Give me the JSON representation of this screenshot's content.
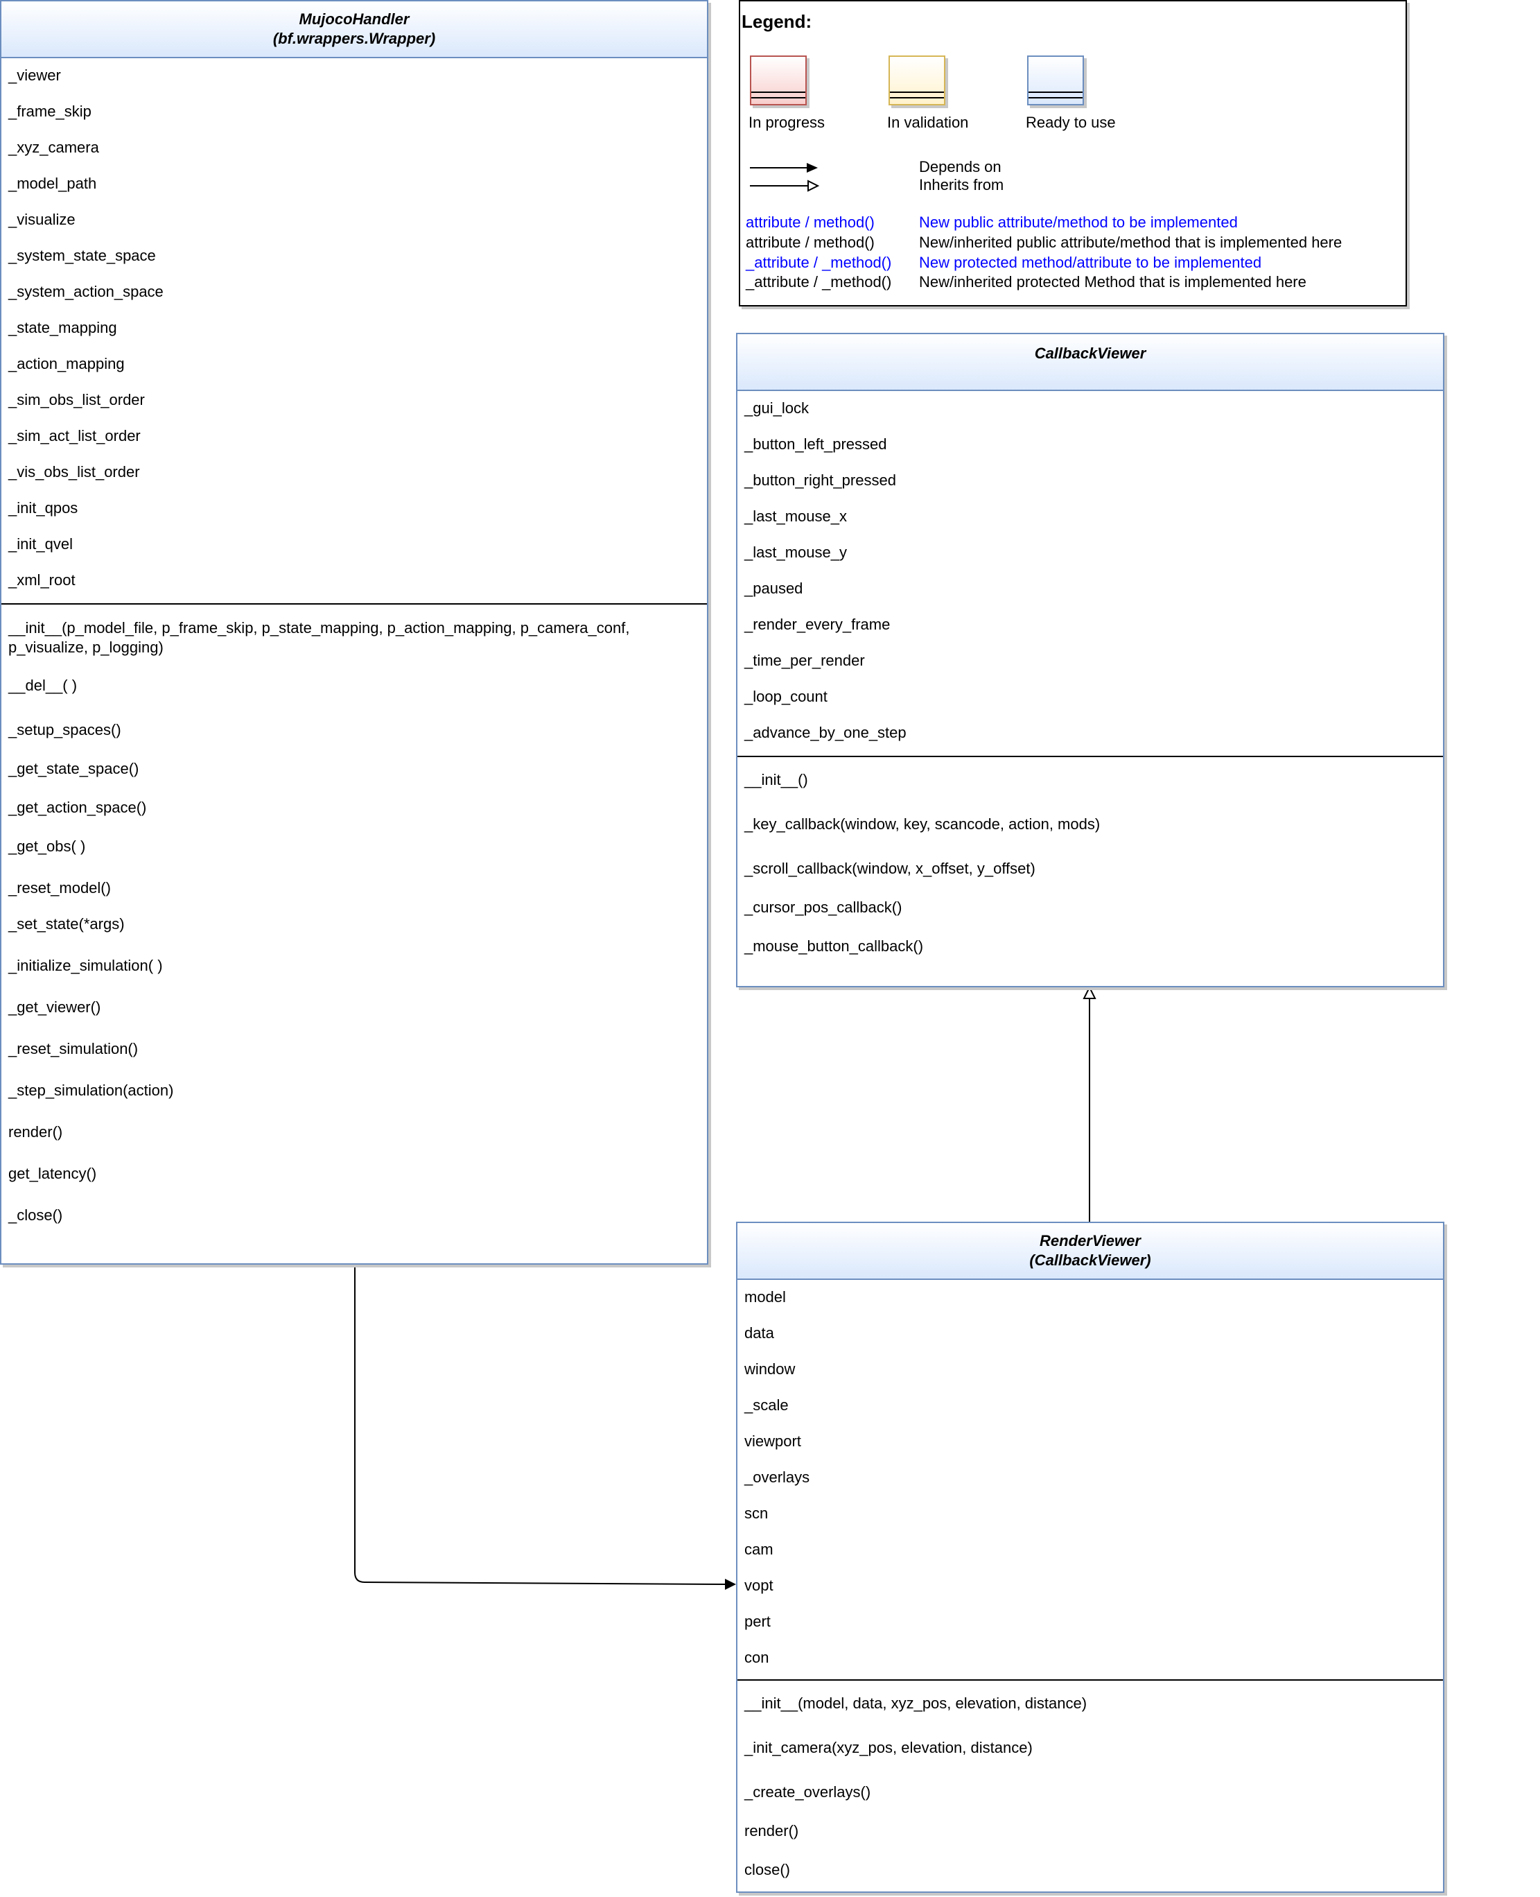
{
  "colors": {
    "in_progress_fill": "#f8cecc",
    "in_progress_border": "#b85450",
    "in_validation_fill": "#fff2cc",
    "in_validation_border": "#d6b656",
    "ready_fill": "#dae8fc",
    "ready_border": "#6c8ebf",
    "blue_text": "#0000ff"
  },
  "legend": {
    "title": "Legend:",
    "statuses": [
      "In progress",
      "In validation",
      "Ready to use"
    ],
    "arrows": {
      "depends": "Depends on",
      "inherits": "Inherits from"
    },
    "rows": [
      {
        "left": "attribute / method()",
        "right": "New public attribute/method to be implemented"
      },
      {
        "left": "attribute / method()",
        "right": "New/inherited public attribute/method that is implemented here"
      },
      {
        "left": "_attribute / _method()",
        "right": "New protected method/attribute to be implemented"
      },
      {
        "left": "_attribute / _method()",
        "right": "New/inherited protected Method that is implemented here"
      }
    ]
  },
  "mujoco": {
    "title": "MujocoHandler",
    "subtitle": "(bf.wrappers.Wrapper)",
    "attributes": [
      "_viewer",
      "_frame_skip",
      "_xyz_camera",
      "_model_path",
      "_visualize",
      "_system_state_space",
      "_system_action_space",
      "_state_mapping",
      "_action_mapping",
      "_sim_obs_list_order",
      "_sim_act_list_order",
      "_vis_obs_list_order",
      "_init_qpos",
      "_init_qvel",
      "_xml_root"
    ],
    "methods": [
      "__init__(p_model_file, p_frame_skip, p_state_mapping, p_action_mapping, p_camera_conf, p_visualize, p_logging)",
      "__del__( )",
      "_setup_spaces()",
      "_get_state_space()",
      "_get_action_space()",
      "_get_obs( )",
      "_reset_model()",
      "_set_state(*args)",
      "_initialize_simulation( )",
      "_get_viewer()",
      "_reset_simulation()",
      "_step_simulation(action)",
      "render()",
      "get_latency()",
      "_close()"
    ]
  },
  "callback": {
    "title": "CallbackViewer",
    "attributes": [
      "_gui_lock",
      "_button_left_pressed",
      "_button_right_pressed",
      "_last_mouse_x",
      "_last_mouse_y",
      "_paused",
      "_render_every_frame",
      "_time_per_render",
      "_loop_count",
      "_advance_by_one_step"
    ],
    "methods": [
      "__init__()",
      "_key_callback(window, key, scancode, action, mods)",
      "_scroll_callback(window, x_offset, y_offset)",
      "_cursor_pos_callback()",
      "_mouse_button_callback()"
    ]
  },
  "render": {
    "title": "RenderViewer",
    "subtitle": "(CallbackViewer)",
    "attributes": [
      "model",
      "data",
      "window",
      "_scale",
      "viewport",
      "_overlays",
      "scn",
      "cam",
      "vopt",
      "pert",
      "con"
    ],
    "methods": [
      "__init__(model, data, xyz_pos, elevation, distance)",
      "_init_camera(xyz_pos, elevation, distance)",
      "_create_overlays()",
      "render()",
      "close()"
    ]
  }
}
